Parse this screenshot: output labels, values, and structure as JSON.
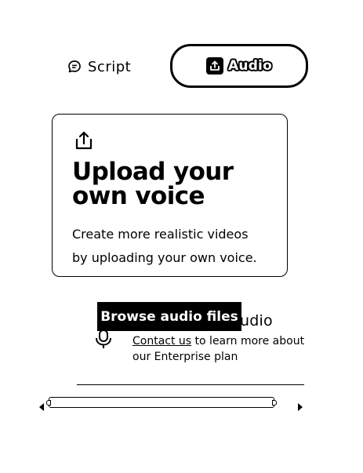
{
  "tabs": {
    "script": {
      "label": "Script",
      "icon": "chat-bubble-icon"
    },
    "audio": {
      "label": "Audio",
      "icon": "upload-icon",
      "active": true
    }
  },
  "upload_card": {
    "icon": "upload-icon",
    "title": "Upload your\nown voice",
    "description": "Create more realistic videos\nby uploading your own voice."
  },
  "browse_button": {
    "label": "Browse audio files"
  },
  "record": {
    "icon": "microphone-icon",
    "title_suffix": "udio",
    "contact_link": "Contact us",
    "enterprise_text": " to learn more about our Enterprise plan"
  },
  "colors": {
    "foreground": "#000000",
    "background": "#ffffff"
  }
}
